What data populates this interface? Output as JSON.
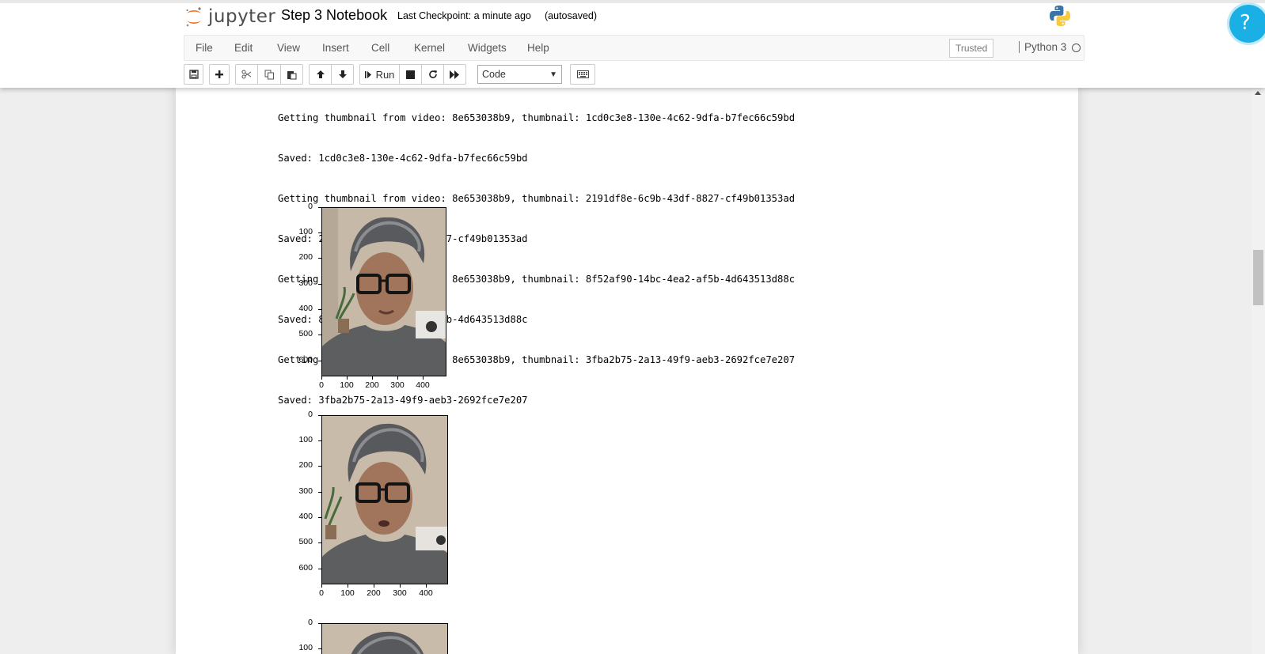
{
  "header": {
    "logo_text": "jupyter",
    "notebook_name": "Step 3 Notebook",
    "checkpoint": "Last Checkpoint: a minute ago",
    "autosave": "(autosaved)"
  },
  "menubar": {
    "items": [
      "File",
      "Edit",
      "View",
      "Insert",
      "Cell",
      "Kernel",
      "Widgets",
      "Help"
    ],
    "trusted": "Trusted",
    "kernel": "Python 3"
  },
  "toolbar": {
    "run_label": "Run",
    "cell_type": "Code",
    "icons": [
      "save-icon",
      "plus-icon",
      "cut-icon",
      "copy-icon",
      "paste-icon",
      "arrow-up-icon",
      "arrow-down-icon",
      "run-icon",
      "stop-icon",
      "restart-icon",
      "fast-forward-icon",
      "keyboard-icon"
    ]
  },
  "help": {
    "icon": "?"
  },
  "output": {
    "lines": [
      "Getting thumbnail from video: 8e653038b9, thumbnail: 1cd0c3e8-130e-4c62-9dfa-b7fec66c59bd",
      "Saved: 1cd0c3e8-130e-4c62-9dfa-b7fec66c59bd",
      "Getting thumbnail from video: 8e653038b9, thumbnail: 2191df8e-6c9b-43df-8827-cf49b01353ad",
      "Saved: 2191df8e-6c9b-43df-8827-cf49b01353ad",
      "Getting thumbnail from video: 8e653038b9, thumbnail: 8f52af90-14bc-4ea2-af5b-4d643513d88c",
      "Saved: 8f52af90-14bc-4ea2-af5b-4d643513d88c",
      "Getting thumbnail from video: 8e653038b9, thumbnail: 3fba2b75-2a13-49f9-aeb3-2692fce7e207",
      "Saved: 3fba2b75-2a13-49f9-aeb3-2692fce7e207"
    ]
  },
  "plots": {
    "yticks": [
      "0",
      "100",
      "200",
      "300",
      "400",
      "500",
      "600"
    ],
    "xticks": [
      "0",
      "100",
      "200",
      "300",
      "400"
    ],
    "partial_yticks": [
      "0",
      "100"
    ]
  },
  "colors": {
    "accent": "#1ab0e5",
    "logo_orange": "#f37726",
    "face_bg": "#c9bcab"
  }
}
